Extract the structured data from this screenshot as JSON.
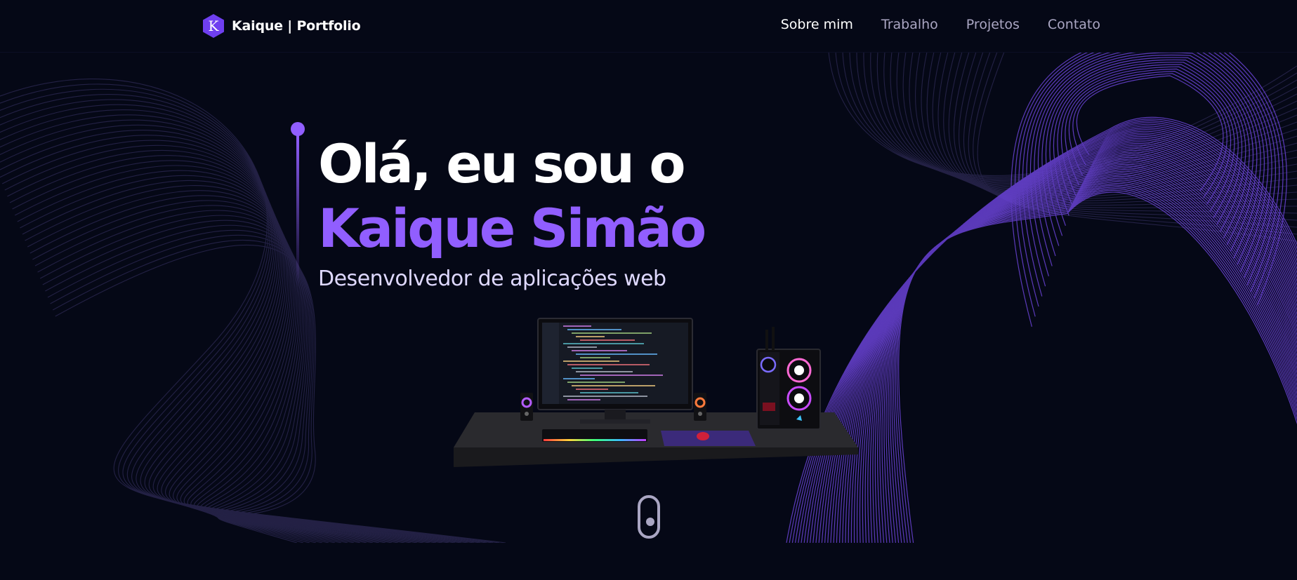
{
  "nav": {
    "logo_letter": "K",
    "logo_text": "Kaique | Portfolio",
    "links": [
      "Sobre mim",
      "Trabalho",
      "Projetos",
      "Contato"
    ],
    "active_link": "Sobre mim"
  },
  "hero": {
    "headline_line1": "Olá, eu sou o",
    "headline_line2": "Kaique Simão",
    "subtitle": "Desenvolvedor de aplicações web"
  },
  "icons": {
    "logo": "hexagon-k-logo-icon",
    "scroll": "mouse-scroll-icon"
  },
  "colors": {
    "background": "#050816",
    "accent": "#915eff",
    "nav_text": "#aaa6c3",
    "nav_active": "#ffffff"
  }
}
